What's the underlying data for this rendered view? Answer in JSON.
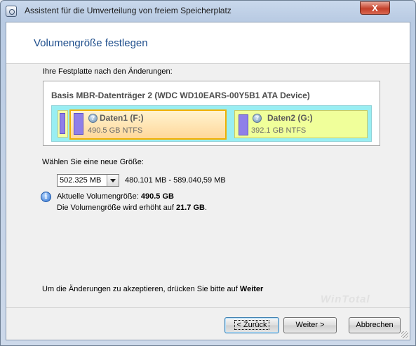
{
  "window": {
    "title": "Assistent für die Umverteilung von freiem Speicherplatz",
    "close_glyph": "X"
  },
  "header": {
    "title": "Volumengröße festlegen"
  },
  "disk": {
    "label": "Ihre Festplatte nach den Änderungen:",
    "name": "Basis MBR-Datenträger 2 (WDC WD10EARS-00Y5B1 ATA Device)",
    "partitions": [
      {
        "name": "Daten1 (F:)",
        "size": "490.5 GB NTFS",
        "selected": true,
        "color": "#ffd89b"
      },
      {
        "name": "Daten2 (G:)",
        "size": "392.1 GB NTFS",
        "selected": false,
        "color": "#f0ff9a"
      }
    ]
  },
  "size": {
    "label": "Wählen Sie eine neue Größe:",
    "value": "502.325 MB",
    "range": "480.101 MB - 589.040,59 MB"
  },
  "info": {
    "line1_prefix": "Aktuelle Volumengröße: ",
    "line1_value": "490.5 GB",
    "line2_prefix": "Die Volumengröße wird erhöht auf ",
    "line2_value": "21.7 GB",
    "line2_suffix": "."
  },
  "footer": {
    "text_prefix": "Um die Änderungen zu akzeptieren, drücken Sie bitte auf ",
    "text_bold": "Weiter"
  },
  "watermark": "WinTotal",
  "buttons": {
    "back": "< Zurück",
    "next": "Weiter >",
    "cancel": "Abbrechen"
  }
}
